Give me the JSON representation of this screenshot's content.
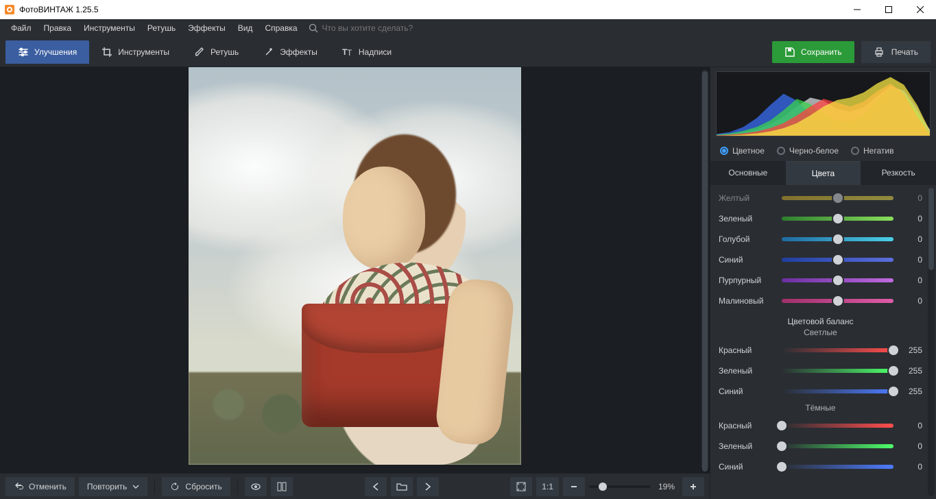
{
  "window": {
    "title": "ФотоВИНТАЖ 1.25.5"
  },
  "menubar": {
    "items": [
      "Файл",
      "Правка",
      "Инструменты",
      "Ретушь",
      "Эффекты",
      "Вид",
      "Справка"
    ],
    "search_placeholder": "Что вы хотите сделать?"
  },
  "toolbar": {
    "tabs": [
      {
        "label": "Улучшения",
        "active": true
      },
      {
        "label": "Инструменты",
        "active": false
      },
      {
        "label": "Ретушь",
        "active": false
      },
      {
        "label": "Эффекты",
        "active": false
      },
      {
        "label": "Надписи",
        "active": false
      }
    ],
    "save_label": "Сохранить",
    "print_label": "Печать"
  },
  "bottombar": {
    "undo": "Отменить",
    "redo": "Повторить",
    "reset": "Сбросить",
    "ratio": "1:1",
    "zoom": "19%"
  },
  "panel": {
    "color_modes": [
      "Цветное",
      "Черно-белое",
      "Негатив"
    ],
    "color_mode_selected": 0,
    "tabs": [
      "Основные",
      "Цвета",
      "Резкость"
    ],
    "tab_selected": 1,
    "partial_row": {
      "label": "Желтый",
      "value": 0,
      "grad": [
        "#caa82a",
        "#e7d84b"
      ],
      "pos": 0.5
    },
    "hue_rows": [
      {
        "label": "Зеленый",
        "value": 0,
        "grad": [
          "#2f7d2f",
          "#8adf5c"
        ],
        "pos": 0.5
      },
      {
        "label": "Голубой",
        "value": 0,
        "grad": [
          "#1f6aa0",
          "#4bd0e7"
        ],
        "pos": 0.5
      },
      {
        "label": "Синий",
        "value": 0,
        "grad": [
          "#1f3fa0",
          "#5c6edf"
        ],
        "pos": 0.5
      },
      {
        "label": "Пурпурный",
        "value": 0,
        "grad": [
          "#6a2fa0",
          "#c06adf"
        ],
        "pos": 0.5
      },
      {
        "label": "Малиновый",
        "value": 0,
        "grad": [
          "#a02f6a",
          "#df5ca8"
        ],
        "pos": 0.5
      }
    ],
    "balance_title": "Цветовой баланс",
    "balance_light_title": "Светлые",
    "balance_light": [
      {
        "label": "Красный",
        "value": 255,
        "grad": [
          "#2a2e33",
          "#ff4d4d"
        ],
        "pos": 1.0
      },
      {
        "label": "Зеленый",
        "value": 255,
        "grad": [
          "#2a2e33",
          "#4dff6a"
        ],
        "pos": 1.0
      },
      {
        "label": "Синий",
        "value": 255,
        "grad": [
          "#2a2e33",
          "#4d7bff"
        ],
        "pos": 1.0
      }
    ],
    "balance_dark_title": "Тёмные",
    "balance_dark": [
      {
        "label": "Красный",
        "value": 0,
        "grad": [
          "#2a2e33",
          "#ff4d4d"
        ],
        "pos": 0.0
      },
      {
        "label": "Зеленый",
        "value": 0,
        "grad": [
          "#2a2e33",
          "#4dff6a"
        ],
        "pos": 0.0
      },
      {
        "label": "Синий",
        "value": 0,
        "grad": [
          "#2a2e33",
          "#4d7bff"
        ],
        "pos": 0.0
      }
    ]
  },
  "chart_data": {
    "type": "area",
    "title": "RGB histogram",
    "xlabel": "",
    "ylabel": "",
    "x": [
      0,
      16,
      32,
      48,
      64,
      80,
      96,
      112,
      128,
      144,
      160,
      176,
      192,
      208,
      224,
      240,
      255
    ],
    "series": [
      {
        "name": "luma",
        "color": "#d8d8d8",
        "values": [
          2,
          3,
          6,
          10,
          18,
          30,
          46,
          60,
          55,
          42,
          38,
          45,
          62,
          78,
          70,
          40,
          10
        ]
      },
      {
        "name": "blue",
        "color": "#3a6cf0",
        "values": [
          3,
          6,
          14,
          28,
          48,
          66,
          55,
          35,
          20,
          14,
          12,
          20,
          40,
          64,
          72,
          44,
          6
        ]
      },
      {
        "name": "green",
        "color": "#38d24c",
        "values": [
          2,
          4,
          8,
          14,
          24,
          40,
          58,
          50,
          34,
          24,
          22,
          32,
          55,
          74,
          68,
          38,
          4
        ]
      },
      {
        "name": "red",
        "color": "#ff4040",
        "values": [
          1,
          2,
          4,
          7,
          12,
          20,
          32,
          46,
          58,
          52,
          46,
          54,
          70,
          82,
          66,
          30,
          3
        ]
      },
      {
        "name": "yellow",
        "color": "#f7e642",
        "values": [
          0,
          1,
          2,
          4,
          7,
          12,
          20,
          32,
          46,
          56,
          60,
          68,
          82,
          92,
          80,
          48,
          8
        ]
      }
    ],
    "xlim": [
      0,
      255
    ],
    "ylim": [
      0,
      100
    ]
  }
}
